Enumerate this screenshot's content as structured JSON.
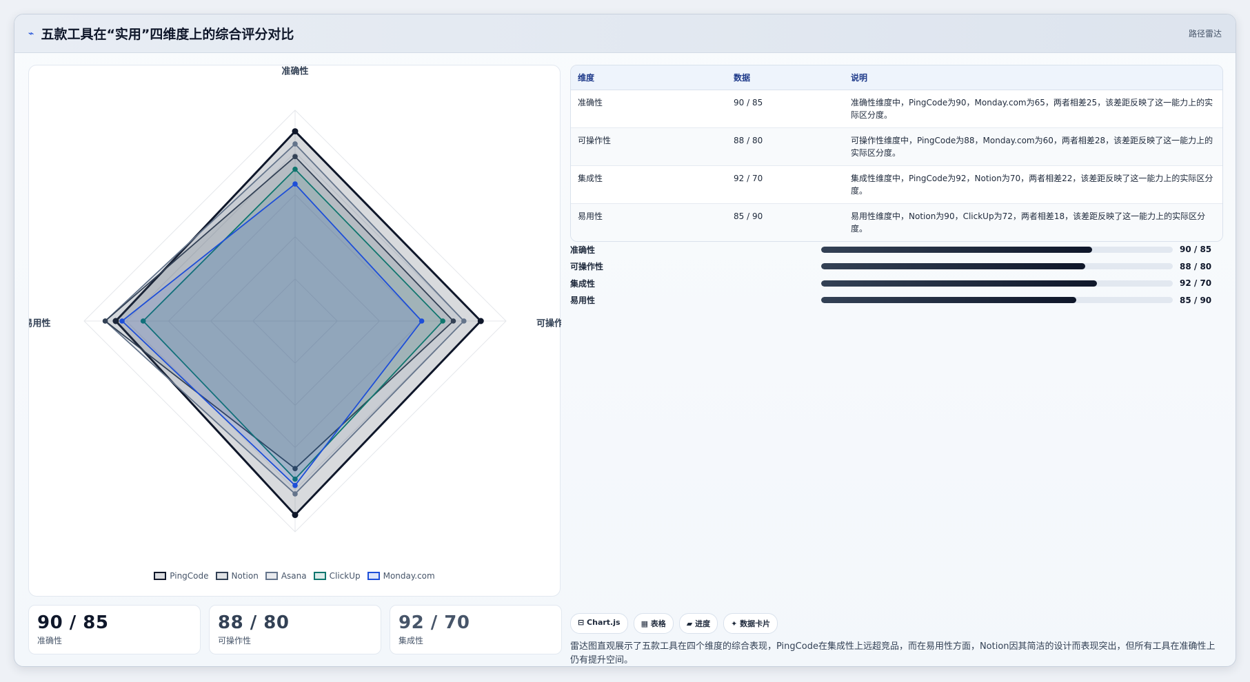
{
  "header": {
    "title_icon": "⌁",
    "title": "五款工具在“实用”四维度上的综合评分对比",
    "tag": "路径雷达"
  },
  "colors": {
    "PingCode": "#0f172a",
    "Notion": "#334155",
    "Asana": "#64748b",
    "ClickUp": "#0f766e",
    "Monday.com": "#1d4ed8"
  },
  "chart_data": {
    "type": "radar",
    "axes": [
      "准确性",
      "可操作性",
      "集成性",
      "易用性"
    ],
    "rmax": 100,
    "grid": true,
    "legend_position": "bottom",
    "series": [
      {
        "name": "PingCode",
        "values": [
          90,
          88,
          92,
          85
        ]
      },
      {
        "name": "Asana",
        "values": [
          84,
          80,
          82,
          90
        ]
      },
      {
        "name": "Notion",
        "values": [
          78,
          75,
          70,
          90
        ]
      },
      {
        "name": "ClickUp",
        "values": [
          72,
          70,
          75,
          72
        ]
      },
      {
        "name": "Monday.com",
        "values": [
          65,
          60,
          78,
          82
        ]
      }
    ]
  },
  "stats": [
    {
      "value": "90 / 85",
      "label": "准确性"
    },
    {
      "value": "88 / 80",
      "label": "可操作性"
    },
    {
      "value": "92 / 70",
      "label": "集成性"
    }
  ],
  "table": {
    "headers": [
      "维度",
      "数据",
      "说明"
    ],
    "rows": [
      {
        "dim": "准确性",
        "data": "90 / 85",
        "desc": "准确性维度中，PingCode为90，Monday.com为65，两者相差25，该差距反映了这一能力上的实际区分度。"
      },
      {
        "dim": "可操作性",
        "data": "88 / 80",
        "desc": "可操作性维度中，PingCode为88，Monday.com为60，两者相差28，该差距反映了这一能力上的实际区分度。"
      },
      {
        "dim": "集成性",
        "data": "92 / 70",
        "desc": "集成性维度中，PingCode为92，Notion为70，两者相差22，该差距反映了这一能力上的实际区分度。"
      },
      {
        "dim": "易用性",
        "data": "85 / 90",
        "desc": "易用性维度中，Notion为90，ClickUp为72，两者相差18，该差距反映了这一能力上的实际区分度。"
      }
    ]
  },
  "bars": [
    {
      "label": "准确性",
      "value": "90 / 85",
      "fill": 0.77
    },
    {
      "label": "可操作性",
      "value": "88 / 80",
      "fill": 0.75
    },
    {
      "label": "集成性",
      "value": "92 / 70",
      "fill": 0.785
    },
    {
      "label": "易用性",
      "value": "85 / 90",
      "fill": 0.725
    }
  ],
  "chips": [
    "⊟ Chart.js",
    "▦ 表格",
    "▰ 进度",
    "✦ 数据卡片"
  ],
  "summary": "雷达图直观展示了五款工具在四个维度的综合表现，PingCode在集成性上远超竞品，而在易用性方面，Notion因其简洁的设计而表现突出，但所有工具在准确性上仍有提升空间。"
}
